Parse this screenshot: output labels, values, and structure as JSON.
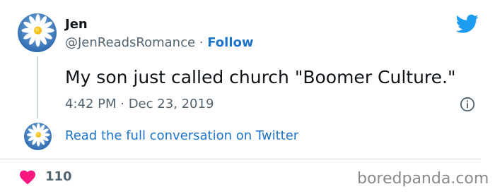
{
  "tweet": {
    "author_name": "Jen",
    "handle": "@JenReadsRomance",
    "separator": " · ",
    "follow_label": "Follow",
    "text": "My son just called church \"Boomer Culture.\"",
    "timestamp": "4:42 PM · Dec 23, 2019",
    "read_conversation_label": "Read the full conversation on Twitter",
    "like_count": "110"
  },
  "icons": {
    "brand": "twitter-bird-icon",
    "info": "info-icon",
    "like": "heart-icon",
    "avatar": "daisy-avatar"
  },
  "colors": {
    "link": "#1d74c9",
    "twitter_blue": "#1d9bf0",
    "heart": "#f91880",
    "muted": "#536471",
    "avatar_sky": "#2b6cb0"
  },
  "watermark": "boredpanda.com"
}
